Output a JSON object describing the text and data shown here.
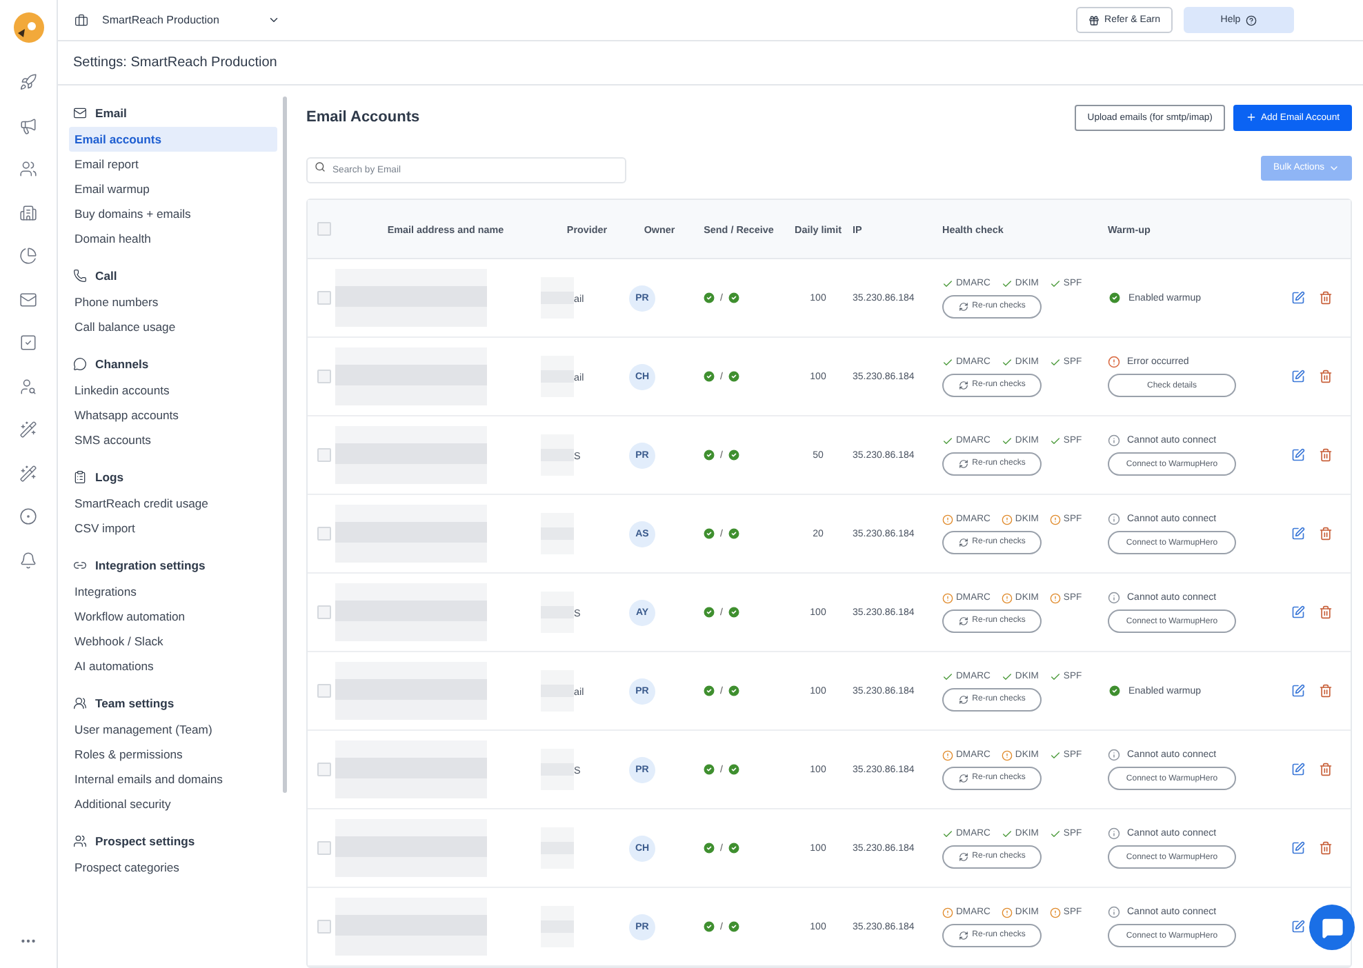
{
  "top_bar": {
    "workspace": "SmartReach Production",
    "buttons": [
      {
        "label": "Refer & Earn",
        "kind": "outline"
      },
      {
        "label": "Help",
        "kind": "soft"
      }
    ]
  },
  "page_title": "Settings: SmartReach Production",
  "settings_nav": [
    {
      "section": "Email",
      "items": [
        {
          "label": "Email accounts",
          "selected": true
        },
        {
          "label": "Email report",
          "selected": false
        },
        {
          "label": "Email warmup",
          "selected": false
        },
        {
          "label": "Buy domains + emails",
          "selected": false
        },
        {
          "label": "Domain health",
          "selected": false
        }
      ]
    },
    {
      "section": "Call",
      "items": [
        {
          "label": "Phone numbers",
          "selected": false
        },
        {
          "label": "Call balance usage",
          "selected": false
        }
      ]
    },
    {
      "section": "Channels",
      "items": [
        {
          "label": "Linkedin accounts",
          "selected": false
        },
        {
          "label": "Whatsapp accounts",
          "selected": false
        },
        {
          "label": "SMS accounts",
          "selected": false
        }
      ]
    },
    {
      "section": "Logs",
      "items": [
        {
          "label": "SmartReach credit usage",
          "selected": false
        },
        {
          "label": "CSV import",
          "selected": false
        }
      ]
    },
    {
      "section": "Integration settings",
      "items": [
        {
          "label": "Integrations",
          "selected": false
        },
        {
          "label": "Workflow automation",
          "selected": false
        },
        {
          "label": "Webhook / Slack",
          "selected": false
        },
        {
          "label": "AI automations",
          "selected": false
        }
      ]
    },
    {
      "section": "Team settings",
      "items": [
        {
          "label": "User management (Team)",
          "selected": false
        },
        {
          "label": "Roles & permissions",
          "selected": false
        },
        {
          "label": "Internal emails and domains",
          "selected": false
        },
        {
          "label": "Additional security",
          "selected": false
        }
      ]
    },
    {
      "section": "Prospect settings",
      "items": [
        {
          "label": "Prospect categories",
          "selected": false
        }
      ]
    }
  ],
  "content": {
    "title": "Email Accounts",
    "actions": [
      {
        "label": "Upload emails (for smtp/imap)",
        "kind": "outline"
      },
      {
        "label": "Add Email Account",
        "kind": "primary"
      }
    ],
    "search": {
      "placeholder": "Search by Email"
    },
    "bulk_actions": {
      "label": "Bulk Actions",
      "disabled": true
    }
  },
  "table": {
    "header_checked": false,
    "columns": [
      "Email address and name",
      "Provider",
      "Owner",
      "Send / Receive",
      "Daily limit",
      "IP",
      "Health check",
      "Warm-up"
    ],
    "rows": [
      {
        "checked": false,
        "provider": "ail",
        "owner": "PR",
        "send": true,
        "separator": "/",
        "receive": true,
        "daily_limit": "100",
        "ip": "35.230.86.184",
        "checks": [
          {
            "label": "DMARC",
            "ok": true
          },
          {
            "label": "DKIM",
            "ok": true
          },
          {
            "label": "SPF",
            "ok": true
          }
        ],
        "rerun": "Re-run checks",
        "warmup": {
          "kind": "enabled",
          "label": "Enabled warmup"
        }
      },
      {
        "checked": false,
        "provider": "ail",
        "owner": "CH",
        "send": true,
        "separator": "/",
        "receive": true,
        "daily_limit": "100",
        "ip": "35.230.86.184",
        "checks": [
          {
            "label": "DMARC",
            "ok": true
          },
          {
            "label": "DKIM",
            "ok": true
          },
          {
            "label": "SPF",
            "ok": true
          }
        ],
        "rerun": "Re-run checks",
        "warmup": {
          "kind": "error",
          "label": "Error occurred",
          "button": "Check details"
        }
      },
      {
        "checked": false,
        "provider": "S",
        "owner": "PR",
        "send": true,
        "separator": "/",
        "receive": true,
        "daily_limit": "50",
        "ip": "35.230.86.184",
        "checks": [
          {
            "label": "DMARC",
            "ok": true
          },
          {
            "label": "DKIM",
            "ok": true
          },
          {
            "label": "SPF",
            "ok": true
          }
        ],
        "rerun": "Re-run checks",
        "warmup": {
          "kind": "blocked",
          "label": "Cannot auto connect",
          "button": "Connect to WarmupHero"
        }
      },
      {
        "checked": false,
        "owner": "AS",
        "send": true,
        "separator": "/",
        "receive": true,
        "daily_limit": "20",
        "ip": "35.230.86.184",
        "checks": [
          {
            "label": "DMARC",
            "ok": false
          },
          {
            "label": "DKIM",
            "ok": false
          },
          {
            "label": "SPF",
            "ok": false
          }
        ],
        "rerun": "Re-run checks",
        "warmup": {
          "kind": "blocked",
          "label": "Cannot auto connect",
          "button": "Connect to WarmupHero"
        }
      },
      {
        "checked": false,
        "provider": "S",
        "owner": "AY",
        "send": true,
        "separator": "/",
        "receive": true,
        "daily_limit": "100",
        "ip": "35.230.86.184",
        "checks": [
          {
            "label": "DMARC",
            "ok": false
          },
          {
            "label": "DKIM",
            "ok": false
          },
          {
            "label": "SPF",
            "ok": false
          }
        ],
        "rerun": "Re-run checks",
        "warmup": {
          "kind": "blocked",
          "label": "Cannot auto connect",
          "button": "Connect to WarmupHero"
        }
      },
      {
        "checked": false,
        "provider": "ail",
        "owner": "PR",
        "send": true,
        "separator": "/",
        "receive": true,
        "daily_limit": "100",
        "ip": "35.230.86.184",
        "checks": [
          {
            "label": "DMARC",
            "ok": true
          },
          {
            "label": "DKIM",
            "ok": true
          },
          {
            "label": "SPF",
            "ok": true
          }
        ],
        "rerun": "Re-run checks",
        "warmup": {
          "kind": "enabled",
          "label": "Enabled warmup"
        }
      },
      {
        "checked": false,
        "provider": "S",
        "owner": "PR",
        "send": true,
        "separator": "/",
        "receive": true,
        "daily_limit": "100",
        "ip": "35.230.86.184",
        "checks": [
          {
            "label": "DMARC",
            "ok": false
          },
          {
            "label": "DKIM",
            "ok": false
          },
          {
            "label": "SPF",
            "ok": true
          }
        ],
        "rerun": "Re-run checks",
        "warmup": {
          "kind": "blocked",
          "label": "Cannot auto connect",
          "button": "Connect to WarmupHero"
        }
      },
      {
        "checked": false,
        "owner": "CH",
        "send": true,
        "separator": "/",
        "receive": true,
        "daily_limit": "100",
        "ip": "35.230.86.184",
        "checks": [
          {
            "label": "DMARC",
            "ok": true
          },
          {
            "label": "DKIM",
            "ok": true
          },
          {
            "label": "SPF",
            "ok": true
          }
        ],
        "rerun": "Re-run checks",
        "warmup": {
          "kind": "blocked",
          "label": "Cannot auto connect",
          "button": "Connect to WarmupHero"
        }
      },
      {
        "checked": false,
        "owner": "PR",
        "send": true,
        "separator": "/",
        "receive": true,
        "daily_limit": "100",
        "ip": "35.230.86.184",
        "checks": [
          {
            "label": "DMARC",
            "ok": false
          },
          {
            "label": "DKIM",
            "ok": false
          },
          {
            "label": "SPF",
            "ok": false
          }
        ],
        "rerun": "Re-run checks",
        "warmup": {
          "kind": "blocked",
          "label": "Cannot auto connect",
          "button": "Connect to WarmupHero"
        }
      }
    ]
  }
}
